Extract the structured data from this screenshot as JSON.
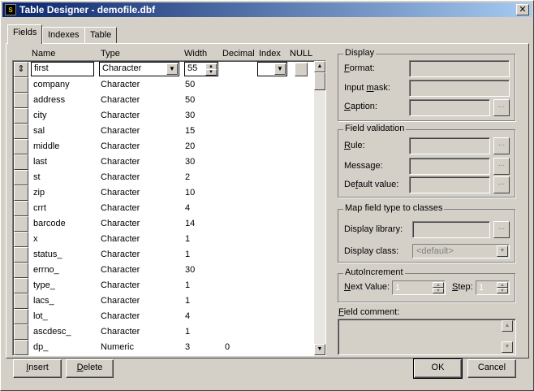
{
  "window": {
    "title": "Table Designer - demofile.dbf",
    "icon_text": "S"
  },
  "tabs": [
    {
      "label": "Fields"
    },
    {
      "label": "Indexes"
    },
    {
      "label": "Table"
    }
  ],
  "columns": {
    "name": "Name",
    "type": "Type",
    "width": "Width",
    "decimal": "Decimal",
    "index": "Index",
    "null": "NULL"
  },
  "edit_row": {
    "name": "first",
    "type": "Character",
    "width": "55",
    "index": ""
  },
  "rows": [
    {
      "name": "company",
      "type": "Character",
      "width": "50",
      "decimal": ""
    },
    {
      "name": "address",
      "type": "Character",
      "width": "50",
      "decimal": ""
    },
    {
      "name": "city",
      "type": "Character",
      "width": "30",
      "decimal": ""
    },
    {
      "name": "sal",
      "type": "Character",
      "width": "15",
      "decimal": ""
    },
    {
      "name": "middle",
      "type": "Character",
      "width": "20",
      "decimal": ""
    },
    {
      "name": "last",
      "type": "Character",
      "width": "30",
      "decimal": ""
    },
    {
      "name": "st",
      "type": "Character",
      "width": "2",
      "decimal": ""
    },
    {
      "name": "zip",
      "type": "Character",
      "width": "10",
      "decimal": ""
    },
    {
      "name": "crrt",
      "type": "Character",
      "width": "4",
      "decimal": ""
    },
    {
      "name": "barcode",
      "type": "Character",
      "width": "14",
      "decimal": ""
    },
    {
      "name": "x",
      "type": "Character",
      "width": "1",
      "decimal": ""
    },
    {
      "name": "status_",
      "type": "Character",
      "width": "1",
      "decimal": ""
    },
    {
      "name": "errno_",
      "type": "Character",
      "width": "30",
      "decimal": ""
    },
    {
      "name": "type_",
      "type": "Character",
      "width": "1",
      "decimal": ""
    },
    {
      "name": "lacs_",
      "type": "Character",
      "width": "1",
      "decimal": ""
    },
    {
      "name": "lot_",
      "type": "Character",
      "width": "4",
      "decimal": ""
    },
    {
      "name": "ascdesc_",
      "type": "Character",
      "width": "1",
      "decimal": ""
    },
    {
      "name": "dp_",
      "type": "Numeric",
      "width": "3",
      "decimal": "0"
    }
  ],
  "display": {
    "title": "Display",
    "format_pre": "",
    "format_u": "F",
    "format_post": "ormat:",
    "input_mask_pre": "Input ",
    "input_mask_u": "m",
    "input_mask_post": "ask:",
    "caption_pre": "",
    "caption_u": "C",
    "caption_post": "aption:"
  },
  "validation": {
    "title": "Field validation",
    "rule_pre": "",
    "rule_u": "R",
    "rule_post": "ule:",
    "message_label": "Message:",
    "default_pre": "De",
    "default_u": "f",
    "default_post": "ault value:"
  },
  "classes": {
    "title": "Map field type to classes",
    "library_label": "Display library:",
    "class_label": "Display class:",
    "class_value": "<default>"
  },
  "autoinc": {
    "title": "AutoIncrement",
    "next_pre": "",
    "next_u": "N",
    "next_post": "ext Value:",
    "next_value": "1",
    "step_pre": "",
    "step_u": "S",
    "step_post": "tep:",
    "step_value": "1"
  },
  "comment": {
    "label_pre": "",
    "label_u": "F",
    "label_post": "ield comment:"
  },
  "buttons": {
    "insert_pre": "",
    "insert_u": "I",
    "insert_post": "nsert",
    "delete_pre": "",
    "delete_u": "D",
    "delete_post": "elete",
    "ok": "OK",
    "cancel": "Cancel"
  }
}
